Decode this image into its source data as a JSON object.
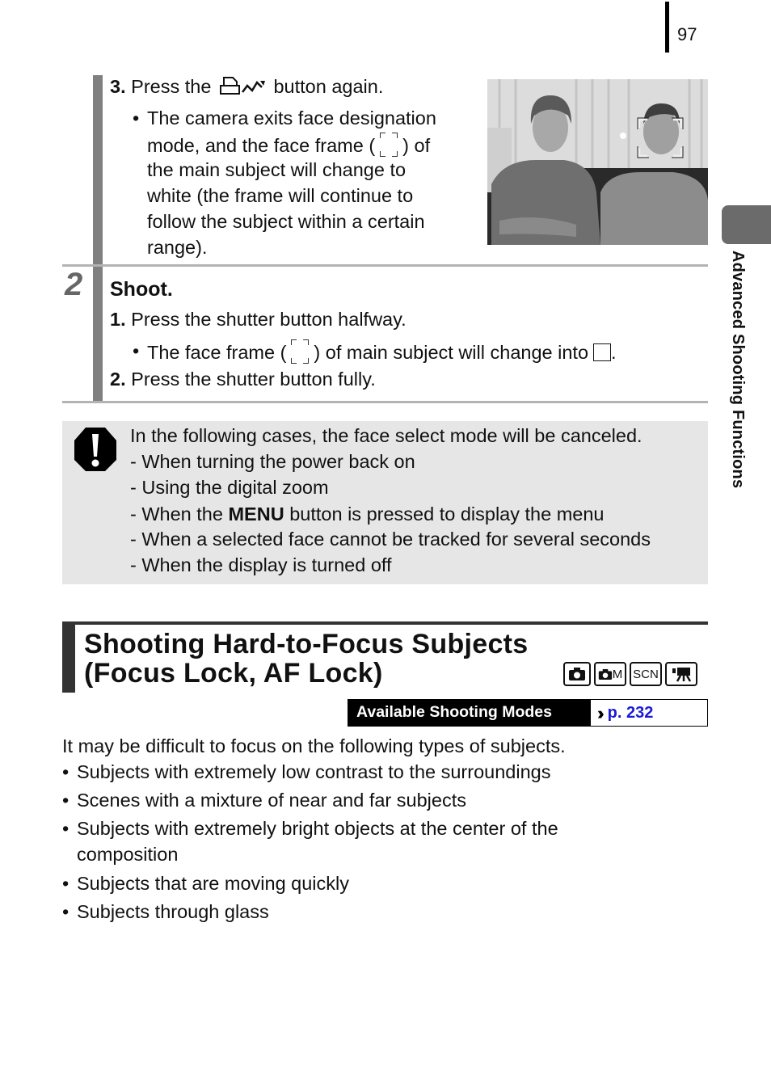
{
  "page_number": "97",
  "side_tab": {
    "label": "Advanced Shooting Functions"
  },
  "step_prev": {
    "substep3": {
      "num": "3.",
      "text_before": "Press the",
      "text_after": "button again."
    },
    "bullet_lines": [
      "The camera exits face designation",
      "mode, and the face frame (",
      ") of",
      "the main subject will change to",
      "white (the frame will continue to",
      "follow the subject within a certain",
      "range)."
    ]
  },
  "step2": {
    "number": "2",
    "title": "Shoot.",
    "sub1": {
      "num": "1.",
      "text": "Press the shutter button halfway."
    },
    "bullet": {
      "before": "The face frame (",
      "after": ") of main subject will change into",
      "end": "."
    },
    "sub2": {
      "num": "2.",
      "text": "Press the shutter button fully."
    }
  },
  "notice": {
    "intro": "In the following cases, the face select mode will be canceled.",
    "items": [
      {
        "text": "When turning the power back on"
      },
      {
        "text": "Using the digital zoom"
      },
      {
        "before": "When the",
        "bold": "MENU",
        "after": "button is pressed to display the menu"
      },
      {
        "text": "When a selected face cannot be tracked for several seconds"
      },
      {
        "text": "When the display is turned off"
      }
    ]
  },
  "section": {
    "title_line1": "Shooting Hard-to-Focus Subjects",
    "title_line2": "(Focus Lock, AF Lock)",
    "mode_icons": [
      "camera-auto-icon",
      "camera-manual-icon",
      "scene-icon",
      "movie-icon"
    ],
    "mode_labels": {
      "m": "M",
      "scn": "SCN"
    },
    "available_label": "Available Shooting Modes",
    "available_link": "p. 232"
  },
  "body": {
    "intro": "It may be difficult to focus on the following types of subjects.",
    "bullets": [
      "Subjects with extremely low contrast to the surroundings",
      "Scenes with a mixture of near and far subjects",
      "Subjects with extremely bright objects at the center of the",
      "composition",
      "Subjects that are moving quickly",
      "Subjects through glass"
    ]
  }
}
